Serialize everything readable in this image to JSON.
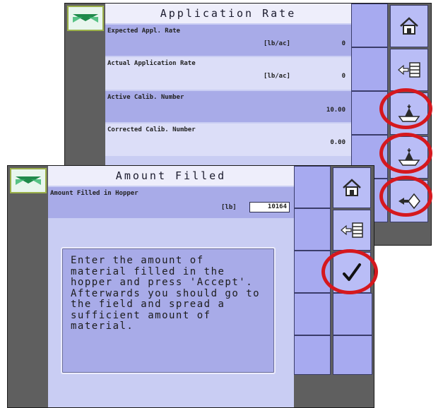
{
  "back_screen": {
    "title": "Application Rate",
    "rows": [
      {
        "label": "Expected Appl. Rate",
        "unit": "[lb/ac]",
        "value": "0"
      },
      {
        "label": "Actual Application Rate",
        "unit": "[lb/ac]",
        "value": "0"
      },
      {
        "label": "Active Calib. Number",
        "unit": "",
        "value": "10.00"
      },
      {
        "label": "Corrected Calib. Number",
        "unit": "",
        "value": "0.00"
      }
    ],
    "buttons": [
      "home-icon",
      "back-list-icon",
      "hopper-fill-icon",
      "hopper-calibrate-icon",
      "next-diamond-icon"
    ]
  },
  "front_screen": {
    "title": "Amount Filled",
    "row": {
      "label": "Amount Filled in Hopper",
      "unit": "[lb]",
      "value": "10164"
    },
    "message": "Enter the amount of material filled in the hopper and press 'Accept'. Afterwards you should go to the field and spread a sufficient amount of material.",
    "buttons": [
      "home-icon",
      "back-list-icon",
      "accept-check-icon"
    ]
  },
  "colors": {
    "highlight": "#d5181e",
    "button": "#b9bdf6",
    "panel": "#c9cdf3"
  }
}
